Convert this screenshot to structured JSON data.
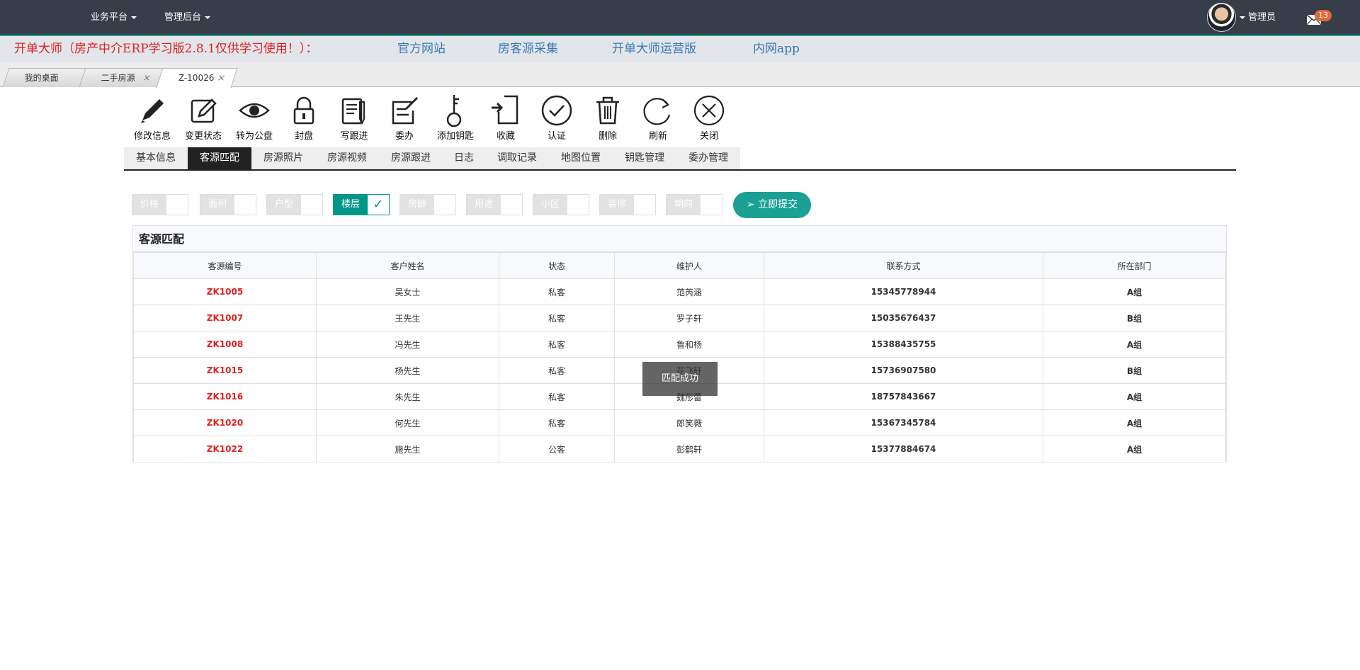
{
  "topbar": {
    "menus": [
      "业务平台",
      "管理后台"
    ],
    "user_label": "管理员",
    "mail_count": "13"
  },
  "notice": {
    "text": "开单大师（房产中介ERP学习版2.8.1仅供学习使用！）：",
    "links": [
      "官方网站",
      "房客源采集",
      "开单大师运营版",
      "内网app"
    ]
  },
  "tabs": [
    {
      "label": "我的桌面",
      "closable": false
    },
    {
      "label": "二手房源",
      "closable": true
    },
    {
      "label": "Z-10026",
      "closable": true,
      "active": true
    }
  ],
  "toolbar": [
    {
      "label": "修改信息",
      "icon": "pencil-icon"
    },
    {
      "label": "变更状态",
      "icon": "edit-box-icon"
    },
    {
      "label": "转为公盘",
      "icon": "eye-icon"
    },
    {
      "label": "封盘",
      "icon": "lock-icon"
    },
    {
      "label": "写跟进",
      "icon": "write-note-icon"
    },
    {
      "label": "委办",
      "icon": "delegate-icon"
    },
    {
      "label": "添加钥匙",
      "icon": "key-icon"
    },
    {
      "label": "收藏",
      "icon": "bookmark-icon"
    },
    {
      "label": "认证",
      "icon": "check-circle-icon"
    },
    {
      "label": "删除",
      "icon": "trash-icon"
    },
    {
      "label": "刷新",
      "icon": "refresh-icon"
    },
    {
      "label": "关闭",
      "icon": "close-circle-icon"
    }
  ],
  "subtabs": [
    "基本信息",
    "客源匹配",
    "房源照片",
    "房源视频",
    "房源跟进",
    "日志",
    "调取记录",
    "地图位置",
    "钥匙管理",
    "委办管理"
  ],
  "active_subtab": "客源匹配",
  "filters": [
    {
      "label": "价格",
      "checked": false
    },
    {
      "label": "面积",
      "checked": false
    },
    {
      "label": "户型",
      "checked": false
    },
    {
      "label": "楼层",
      "checked": true
    },
    {
      "label": "房龄",
      "checked": false
    },
    {
      "label": "用途",
      "checked": false
    },
    {
      "label": "小区",
      "checked": false
    },
    {
      "label": "装修",
      "checked": false
    },
    {
      "label": "朝向",
      "checked": false
    }
  ],
  "submit_label": "立即提交",
  "panel": {
    "title": "客源匹配",
    "columns": [
      "客源编号",
      "客户姓名",
      "状态",
      "维护人",
      "联系方式",
      "所在部门"
    ],
    "rows": [
      [
        "ZK1005",
        "吴女士",
        "私客",
        "范芮涵",
        "15345778944",
        "A组"
      ],
      [
        "ZK1007",
        "王先生",
        "私客",
        "罗子轩",
        "15035676437",
        "B组"
      ],
      [
        "ZK1008",
        "冯先生",
        "私客",
        "鲁和杨",
        "15388435755",
        "A组"
      ],
      [
        "ZK1015",
        "杨先生",
        "私客",
        "花飞轩",
        "15736907580",
        "B组"
      ],
      [
        "ZK1016",
        "朱先生",
        "私客",
        "魏彤蕾",
        "18757843667",
        "A组"
      ],
      [
        "ZK1020",
        "何先生",
        "私客",
        "郎笑薇",
        "15367345784",
        "A组"
      ],
      [
        "ZK1022",
        "施先生",
        "公客",
        "彭鹤轩",
        "15377884674",
        "A组"
      ]
    ]
  },
  "toast": "匹配成功",
  "colors": {
    "accent": "#009688",
    "topbar": "#373d49",
    "code_red": "#e02020",
    "link_blue": "#3a78b6"
  }
}
